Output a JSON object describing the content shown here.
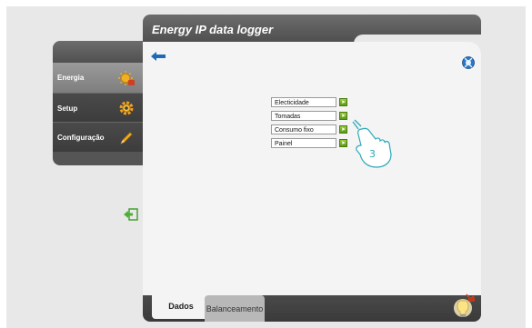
{
  "header": {
    "title": "Energy IP data logger"
  },
  "sidebar": {
    "items": [
      {
        "label": "Energia",
        "icon": "energy-icon"
      },
      {
        "label": "Setup",
        "icon": "gear-icon"
      },
      {
        "label": "Configuração",
        "icon": "pencil-icon"
      }
    ]
  },
  "menu": {
    "items": [
      {
        "label": "Electicidade"
      },
      {
        "label": "Tomadas"
      },
      {
        "label": "Consumo fixo"
      },
      {
        "label": "Painel"
      }
    ]
  },
  "footer": {
    "tabs": [
      {
        "label": "Dados",
        "active": true
      },
      {
        "label": "Balanceamento",
        "active": false
      }
    ]
  },
  "annotation": {
    "step_number": "3"
  },
  "colors": {
    "accent_green": "#6aa81e",
    "back_arrow_blue": "#1e6ab4"
  }
}
